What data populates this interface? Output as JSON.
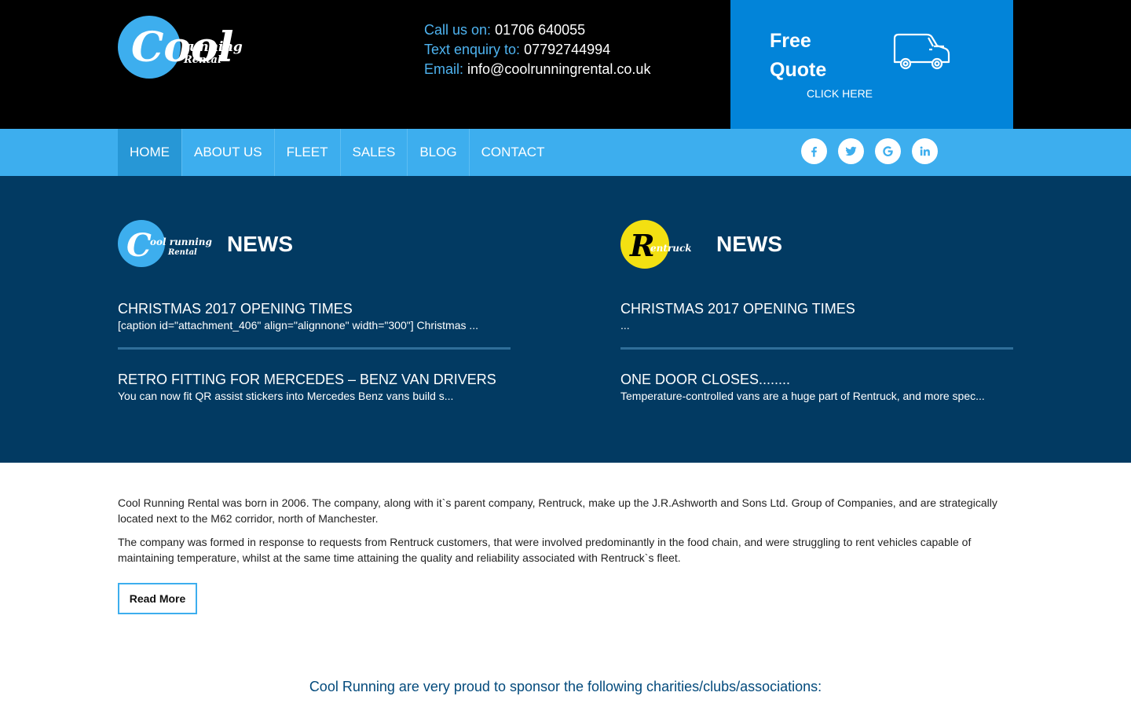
{
  "header": {
    "logo": {
      "main": "Cool",
      "line1": "running",
      "line2": "Rental"
    },
    "contact": {
      "call_label": "Call us on:",
      "call_value": "01706 640055",
      "text_label": "Text enquiry to:",
      "text_value": "07792744994",
      "email_label": "Email:",
      "email_value": "info@coolrunningrental.co.uk"
    },
    "quote": {
      "title": "Free Quote",
      "cta": "CLICK HERE",
      "icon": "van-icon"
    }
  },
  "nav": {
    "items": [
      {
        "label": "HOME",
        "active": true
      },
      {
        "label": "ABOUT US"
      },
      {
        "label": "FLEET"
      },
      {
        "label": "SALES"
      },
      {
        "label": "BLOG"
      },
      {
        "label": "CONTACT"
      }
    ],
    "social": [
      "facebook-icon",
      "twitter-icon",
      "google-icon",
      "linkedin-icon"
    ]
  },
  "news": {
    "left": {
      "brand": {
        "main": "C",
        "line1": "ool running",
        "line2": "Rental"
      },
      "heading": "NEWS",
      "articles": [
        {
          "title": "CHRISTMAS 2017 OPENING TIMES",
          "excerpt": "[caption id=\"attachment_406\" align=\"alignnone\" width=\"300\"] Christmas ..."
        },
        {
          "title": "RETRO FITTING FOR MERCEDES – BENZ VAN DRIVERS",
          "excerpt": "You can now fit QR assist stickers into Mercedes Benz vans build s..."
        }
      ]
    },
    "right": {
      "brand": {
        "main": "R",
        "line1": "entruck"
      },
      "heading": "NEWS",
      "articles": [
        {
          "title": "CHRISTMAS 2017 OPENING TIMES",
          "excerpt": "..."
        },
        {
          "title": "ONE DOOR CLOSES........",
          "excerpt": "Temperature-controlled vans are a huge part of Rentruck, and more spec..."
        }
      ]
    }
  },
  "about": {
    "p1": "Cool Running Rental was born in 2006. The company, along with it`s parent company, Rentruck, make up the J.R.Ashworth and Sons Ltd. Group of Companies, and are strategically located next to the M62 corridor, north of Manchester.",
    "p2": "The company was formed in response to requests from Rentruck customers, that were involved predominantly in the food chain, and were struggling to rent vehicles capable of maintaining temperature, whilst at the same time attaining the quality and reliability associated with Rentruck`s fleet.",
    "read_more": "Read More"
  },
  "sponsor": "Cool Running are very proud to sponsor the following charities/clubs/associations:",
  "colors": {
    "header_bg": "#000000",
    "quote_bg": "#0284d9",
    "nav_bg": "#3daeee",
    "nav_active": "#2797d6",
    "news_bg": "#023a62",
    "accent_label": "#4eb3f0",
    "sponsor_text": "#034a7c",
    "rentruck_yellow": "#f3e012"
  }
}
